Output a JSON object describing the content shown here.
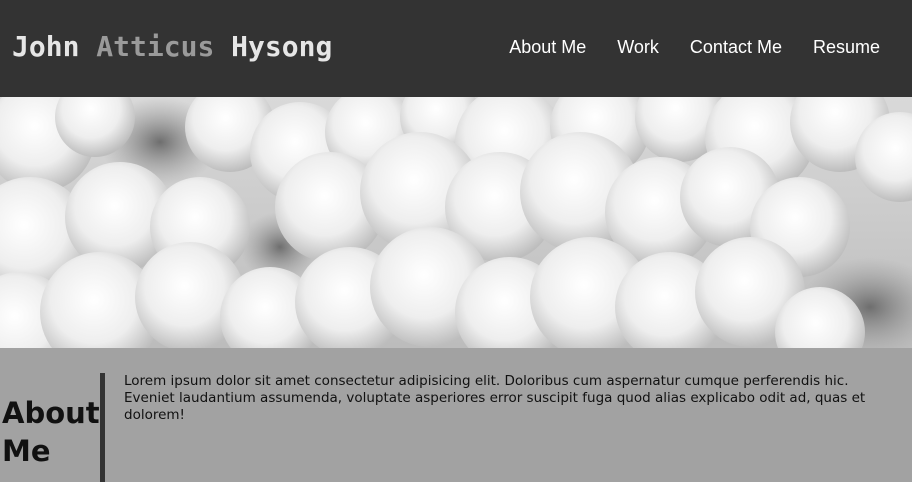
{
  "header": {
    "title_first": "John",
    "title_middle": "Atticus",
    "title_last": "Hysong",
    "nav": [
      {
        "label": "About Me"
      },
      {
        "label": "Work"
      },
      {
        "label": "Contact Me"
      },
      {
        "label": "Resume"
      }
    ]
  },
  "about": {
    "heading": "About Me",
    "body": "Lorem ipsum dolor sit amet consectetur adipisicing elit. Doloribus cum aspernatur cumque perferendis hic. Eveniet laudantium assumenda, voluptate asperiores error suscipit fuga quod alias explicabo odit ad, quas et dolorem!"
  },
  "colors": {
    "header_bg": "#333333",
    "title_light": "#e6e6e6",
    "title_mid": "#9a9a9a",
    "section_bg": "#a2a2a2",
    "divider": "#333333"
  }
}
